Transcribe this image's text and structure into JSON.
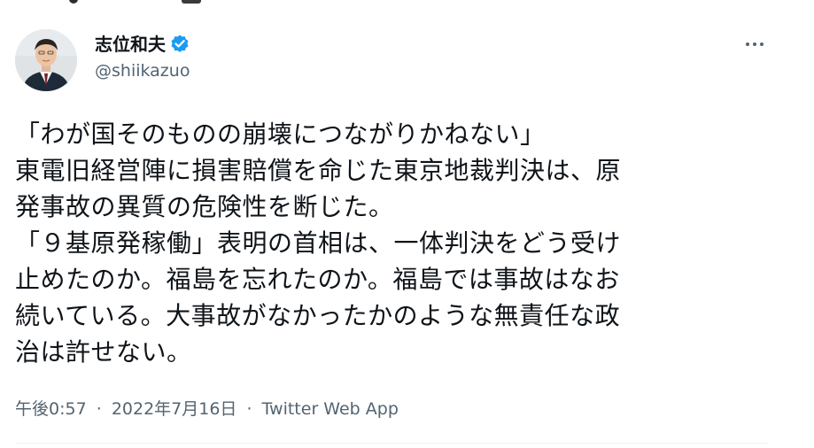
{
  "tweet": {
    "author": {
      "display_name": "志位和夫",
      "handle": "@shiikazuo",
      "verified": true,
      "verified_color": "#1d9bf0"
    },
    "more_icon": "more-horizontal-icon",
    "text_lines": [
      "「わが国そのものの崩壊につながりかねない」",
      "東電旧経営陣に損害賠償を命じた東京地裁判決は、原",
      "発事故の異質の危険性を断じた。",
      "「９基原発稼働」表明の首相は、一体判決をどう受け",
      "止めたのか。福島を忘れたのか。福島では事故はなお",
      "続いている。大事故がなかったかのような無責任な政",
      "治は許せない。"
    ],
    "meta": {
      "time": "午後0:57",
      "separator": "·",
      "date": "2022年7月16日",
      "source": "Twitter Web App"
    }
  },
  "colors": {
    "text_primary": "#0f1419",
    "text_secondary": "#536471",
    "divider": "#eff3f4"
  }
}
